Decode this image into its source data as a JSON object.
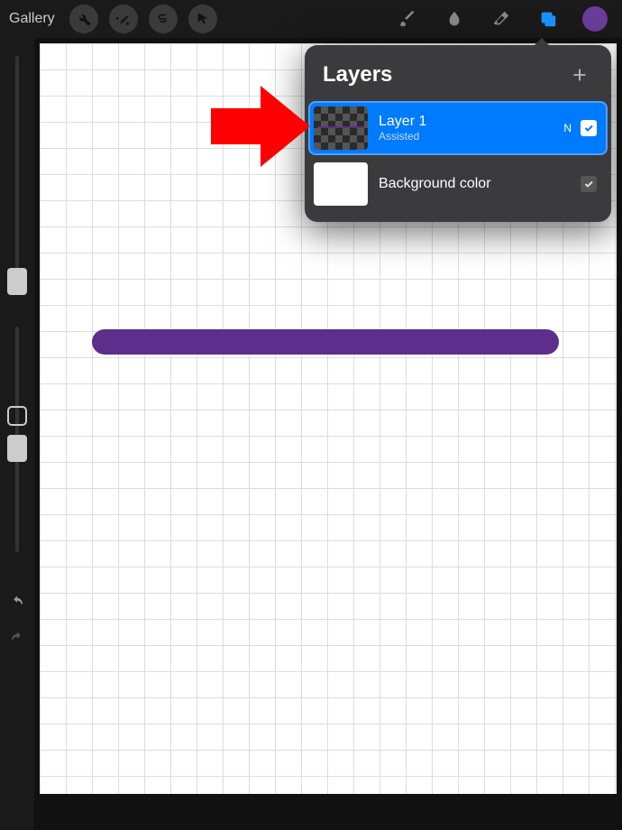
{
  "topbar": {
    "gallery_label": "Gallery"
  },
  "layers_panel": {
    "title": "Layers",
    "layers": [
      {
        "name": "Layer 1",
        "subtitle": "Assisted",
        "blend": "N",
        "visible": true,
        "selected": true
      },
      {
        "name": "Background color",
        "subtitle": "",
        "blend": "",
        "visible": true,
        "selected": false
      }
    ]
  },
  "colors": {
    "current_color": "#6a3d99",
    "stroke_color": "#5d2e8c"
  }
}
